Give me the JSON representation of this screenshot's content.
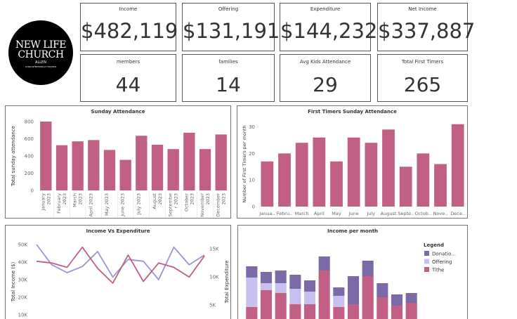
{
  "logo": {
    "line1": "NEW LIFE",
    "line2": "CHURCH",
    "line3": "ALLEN",
    "tagline": "LIVING INTENTIONALLY FOR JESUS"
  },
  "kpis": {
    "income": {
      "label": "Income",
      "value": "$482,119"
    },
    "offering": {
      "label": "Offering",
      "value": "$131,191"
    },
    "expenditure": {
      "label": "Expenditure",
      "value": "$144,232"
    },
    "net_income": {
      "label": "Net Income",
      "value": "$337,887"
    },
    "members": {
      "label": "members",
      "value": "44"
    },
    "families": {
      "label": "families",
      "value": "14"
    },
    "avg_kids": {
      "label": "Avg Kids Attendance",
      "value": "29"
    },
    "first_timers": {
      "label": "Total First Timers",
      "value": "265"
    }
  },
  "chart_data": [
    {
      "id": "sunday",
      "type": "bar",
      "title": "Sunday Attendance",
      "ylabel": "Total sunday attendance",
      "color": "#c25f84",
      "ylim": [
        0,
        800
      ],
      "yticks": [
        "0",
        "200",
        "400",
        "600",
        "800"
      ],
      "categories": [
        [
          "January",
          "2023"
        ],
        [
          "February",
          "2023"
        ],
        [
          "March",
          "2023"
        ],
        [
          "April 2023"
        ],
        [
          "May 2023"
        ],
        [
          "June 2023"
        ],
        [
          "July 2023"
        ],
        [
          "August",
          "2023"
        ],
        [
          "Septembe",
          "r 2023"
        ],
        [
          "October",
          "2023"
        ],
        [
          "November",
          "2023"
        ],
        [
          "December",
          "2023"
        ]
      ],
      "values": [
        800,
        525,
        570,
        585,
        470,
        355,
        635,
        530,
        480,
        670,
        480,
        650
      ]
    },
    {
      "id": "firsttimers",
      "type": "bar",
      "title": "First Timers Sunday Attendance",
      "ylabel": "Number of First Timers per month",
      "color": "#c25f84",
      "ylim": [
        0,
        32
      ],
      "yticks": [
        "0",
        "10",
        "20",
        "30"
      ],
      "categories": [
        "Janua..",
        "Febru..",
        "March",
        "April",
        "May",
        "June",
        "July",
        "August",
        "Septe..",
        "Octob..",
        "Nove..",
        "Dece.."
      ],
      "values": [
        17,
        20,
        24,
        26,
        17,
        26,
        24,
        29,
        15,
        20,
        16,
        31
      ]
    },
    {
      "id": "incexp",
      "type": "line",
      "title": "Income Vs Expenditure",
      "ylabel": "Total Income ($)",
      "y2label": "Total Expenditure",
      "yticks": [
        "50K",
        "40K",
        "30K",
        "20K",
        "10K"
      ],
      "y2ticks": [
        "15K",
        "10K",
        "5K"
      ],
      "series": [
        {
          "color": "#9b96d0",
          "values": [
            50000,
            38500,
            34000,
            37500,
            46000,
            31500,
            41500,
            40500,
            30000,
            48500,
            38500,
            44000
          ]
        },
        {
          "color": "#c25f84",
          "values": [
            40500,
            39500,
            37000,
            48500,
            36500,
            28000,
            44000,
            29000,
            39500,
            37000,
            31500,
            43500
          ]
        }
      ]
    },
    {
      "id": "incmonth",
      "type": "bar",
      "stacked": true,
      "title": "Income per month",
      "legend": {
        "title": "Legend",
        "position": "right"
      },
      "series": [
        {
          "name": "Tithe",
          "color": "#c25f84",
          "values": [
            17,
            29,
            27,
            19,
            19,
            43,
            17,
            19,
            39,
            24,
            18,
            20
          ]
        },
        {
          "name": "Offering",
          "color": "#c7bfee",
          "values": [
            21,
            5,
            7,
            11,
            9,
            0,
            8,
            0,
            0,
            0,
            0,
            0
          ]
        },
        {
          "name": "Donatio...",
          "color": "#7c6aa8",
          "values": [
            8,
            8,
            9,
            10,
            8,
            10,
            6,
            20,
            11,
            10,
            8,
            7
          ]
        }
      ]
    }
  ]
}
